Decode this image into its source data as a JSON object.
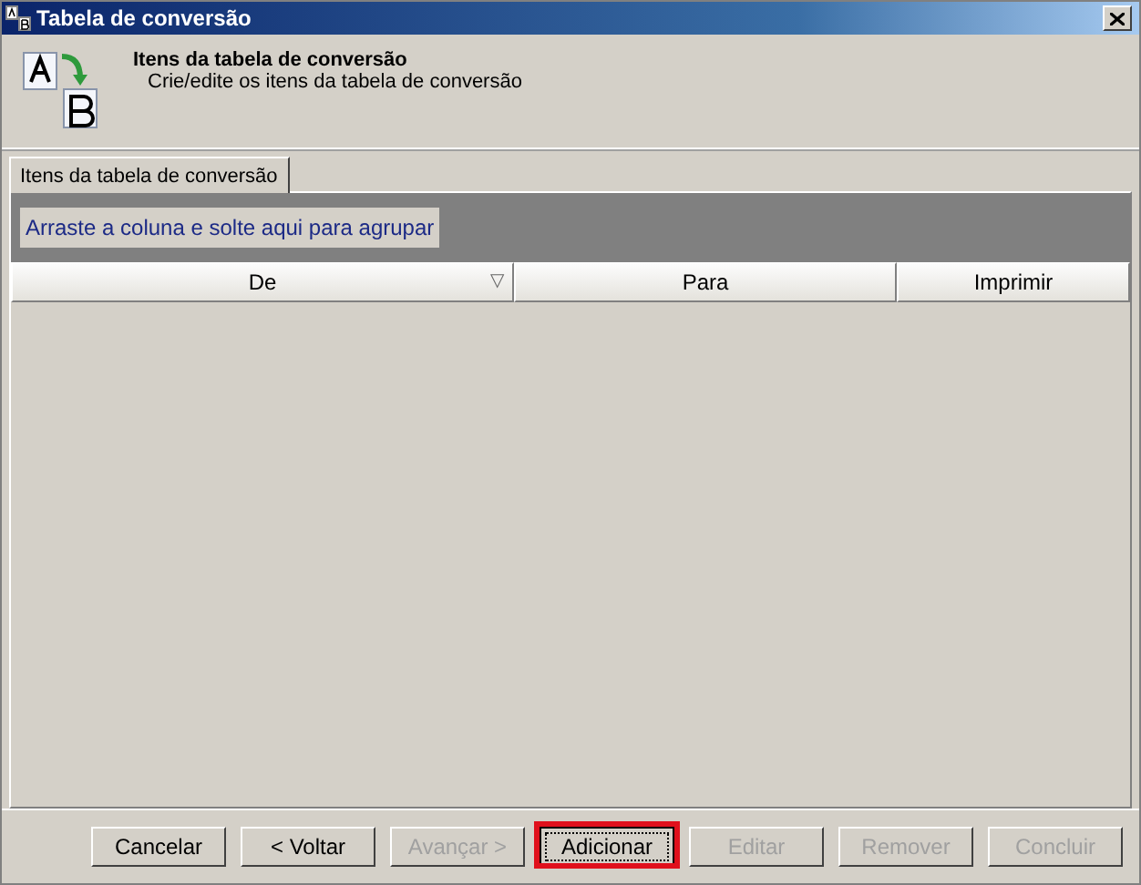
{
  "window": {
    "title": "Tabela de conversão"
  },
  "header": {
    "title": "Itens da tabela de conversão",
    "subtitle": "Crie/edite os itens da tabela de conversão"
  },
  "tabs": [
    {
      "label": "Itens da tabela de conversão",
      "selected": true
    }
  ],
  "grid": {
    "group_hint": "Arraste a coluna e solte aqui para agrupar",
    "columns": [
      {
        "label": "De",
        "sort_icon": "▽"
      },
      {
        "label": "Para"
      },
      {
        "label": "Imprimir"
      }
    ]
  },
  "buttons": [
    {
      "label": "Cancelar",
      "disabled": false,
      "highlighted": false
    },
    {
      "label": "< Voltar",
      "disabled": false,
      "highlighted": false
    },
    {
      "label": "Avançar >",
      "disabled": true,
      "highlighted": false
    },
    {
      "label": "Adicionar",
      "disabled": false,
      "highlighted": true
    },
    {
      "label": "Editar",
      "disabled": true,
      "highlighted": false
    },
    {
      "label": "Remover",
      "disabled": true,
      "highlighted": false
    },
    {
      "label": "Concluir",
      "disabled": true,
      "highlighted": false
    }
  ]
}
